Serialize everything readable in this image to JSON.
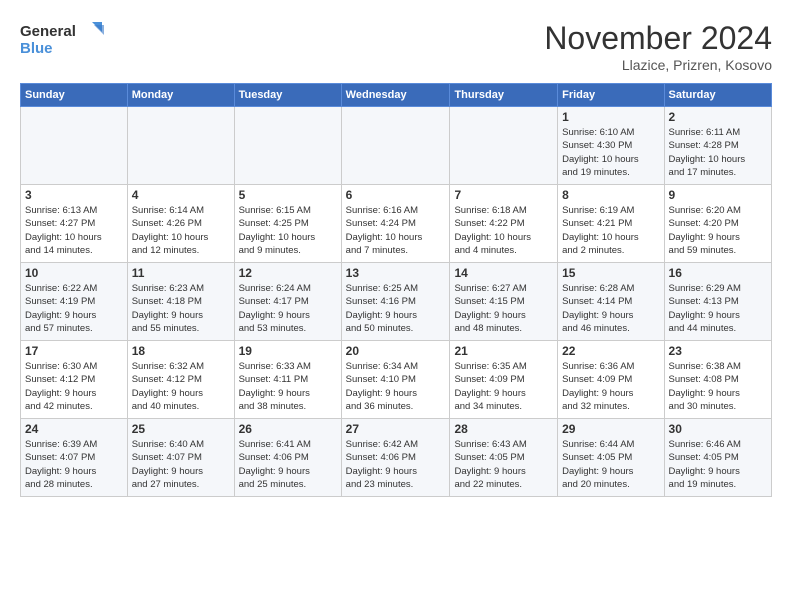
{
  "logo": {
    "line1": "General",
    "line2": "Blue"
  },
  "title": "November 2024",
  "subtitle": "Llazice, Prizren, Kosovo",
  "header_days": [
    "Sunday",
    "Monday",
    "Tuesday",
    "Wednesday",
    "Thursday",
    "Friday",
    "Saturday"
  ],
  "weeks": [
    [
      {
        "day": "",
        "detail": ""
      },
      {
        "day": "",
        "detail": ""
      },
      {
        "day": "",
        "detail": ""
      },
      {
        "day": "",
        "detail": ""
      },
      {
        "day": "",
        "detail": ""
      },
      {
        "day": "1",
        "detail": "Sunrise: 6:10 AM\nSunset: 4:30 PM\nDaylight: 10 hours\nand 19 minutes."
      },
      {
        "day": "2",
        "detail": "Sunrise: 6:11 AM\nSunset: 4:28 PM\nDaylight: 10 hours\nand 17 minutes."
      }
    ],
    [
      {
        "day": "3",
        "detail": "Sunrise: 6:13 AM\nSunset: 4:27 PM\nDaylight: 10 hours\nand 14 minutes."
      },
      {
        "day": "4",
        "detail": "Sunrise: 6:14 AM\nSunset: 4:26 PM\nDaylight: 10 hours\nand 12 minutes."
      },
      {
        "day": "5",
        "detail": "Sunrise: 6:15 AM\nSunset: 4:25 PM\nDaylight: 10 hours\nand 9 minutes."
      },
      {
        "day": "6",
        "detail": "Sunrise: 6:16 AM\nSunset: 4:24 PM\nDaylight: 10 hours\nand 7 minutes."
      },
      {
        "day": "7",
        "detail": "Sunrise: 6:18 AM\nSunset: 4:22 PM\nDaylight: 10 hours\nand 4 minutes."
      },
      {
        "day": "8",
        "detail": "Sunrise: 6:19 AM\nSunset: 4:21 PM\nDaylight: 10 hours\nand 2 minutes."
      },
      {
        "day": "9",
        "detail": "Sunrise: 6:20 AM\nSunset: 4:20 PM\nDaylight: 9 hours\nand 59 minutes."
      }
    ],
    [
      {
        "day": "10",
        "detail": "Sunrise: 6:22 AM\nSunset: 4:19 PM\nDaylight: 9 hours\nand 57 minutes."
      },
      {
        "day": "11",
        "detail": "Sunrise: 6:23 AM\nSunset: 4:18 PM\nDaylight: 9 hours\nand 55 minutes."
      },
      {
        "day": "12",
        "detail": "Sunrise: 6:24 AM\nSunset: 4:17 PM\nDaylight: 9 hours\nand 53 minutes."
      },
      {
        "day": "13",
        "detail": "Sunrise: 6:25 AM\nSunset: 4:16 PM\nDaylight: 9 hours\nand 50 minutes."
      },
      {
        "day": "14",
        "detail": "Sunrise: 6:27 AM\nSunset: 4:15 PM\nDaylight: 9 hours\nand 48 minutes."
      },
      {
        "day": "15",
        "detail": "Sunrise: 6:28 AM\nSunset: 4:14 PM\nDaylight: 9 hours\nand 46 minutes."
      },
      {
        "day": "16",
        "detail": "Sunrise: 6:29 AM\nSunset: 4:13 PM\nDaylight: 9 hours\nand 44 minutes."
      }
    ],
    [
      {
        "day": "17",
        "detail": "Sunrise: 6:30 AM\nSunset: 4:12 PM\nDaylight: 9 hours\nand 42 minutes."
      },
      {
        "day": "18",
        "detail": "Sunrise: 6:32 AM\nSunset: 4:12 PM\nDaylight: 9 hours\nand 40 minutes."
      },
      {
        "day": "19",
        "detail": "Sunrise: 6:33 AM\nSunset: 4:11 PM\nDaylight: 9 hours\nand 38 minutes."
      },
      {
        "day": "20",
        "detail": "Sunrise: 6:34 AM\nSunset: 4:10 PM\nDaylight: 9 hours\nand 36 minutes."
      },
      {
        "day": "21",
        "detail": "Sunrise: 6:35 AM\nSunset: 4:09 PM\nDaylight: 9 hours\nand 34 minutes."
      },
      {
        "day": "22",
        "detail": "Sunrise: 6:36 AM\nSunset: 4:09 PM\nDaylight: 9 hours\nand 32 minutes."
      },
      {
        "day": "23",
        "detail": "Sunrise: 6:38 AM\nSunset: 4:08 PM\nDaylight: 9 hours\nand 30 minutes."
      }
    ],
    [
      {
        "day": "24",
        "detail": "Sunrise: 6:39 AM\nSunset: 4:07 PM\nDaylight: 9 hours\nand 28 minutes."
      },
      {
        "day": "25",
        "detail": "Sunrise: 6:40 AM\nSunset: 4:07 PM\nDaylight: 9 hours\nand 27 minutes."
      },
      {
        "day": "26",
        "detail": "Sunrise: 6:41 AM\nSunset: 4:06 PM\nDaylight: 9 hours\nand 25 minutes."
      },
      {
        "day": "27",
        "detail": "Sunrise: 6:42 AM\nSunset: 4:06 PM\nDaylight: 9 hours\nand 23 minutes."
      },
      {
        "day": "28",
        "detail": "Sunrise: 6:43 AM\nSunset: 4:05 PM\nDaylight: 9 hours\nand 22 minutes."
      },
      {
        "day": "29",
        "detail": "Sunrise: 6:44 AM\nSunset: 4:05 PM\nDaylight: 9 hours\nand 20 minutes."
      },
      {
        "day": "30",
        "detail": "Sunrise: 6:46 AM\nSunset: 4:05 PM\nDaylight: 9 hours\nand 19 minutes."
      }
    ]
  ]
}
